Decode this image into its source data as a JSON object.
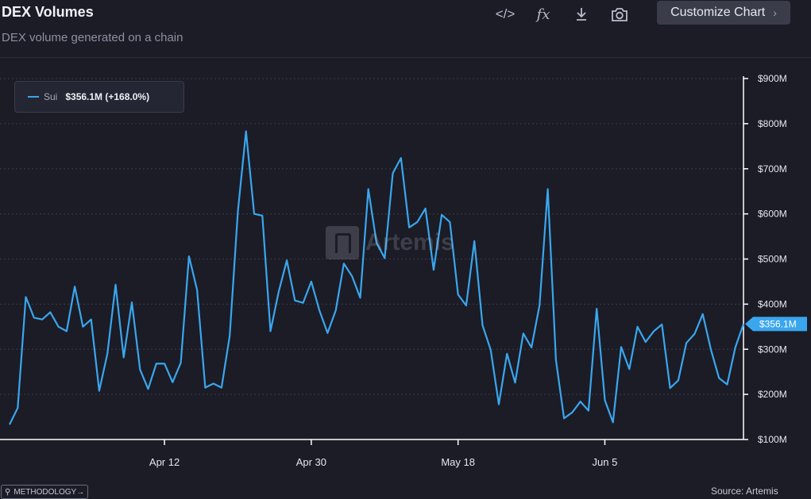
{
  "header": {
    "title": "DEX Volumes",
    "subtitle": "DEX volume generated on a chain",
    "tools": [
      {
        "icon": "code-embed-icon",
        "glyph": "</>"
      },
      {
        "icon": "formula-fx-icon",
        "glyph": "fx"
      },
      {
        "icon": "download-icon"
      },
      {
        "icon": "camera-icon"
      }
    ],
    "customize_label": "Customize Chart",
    "customize_chevron": "›"
  },
  "legend": {
    "series_name": "Sui",
    "value_label": "$356.1M (+168.0%)"
  },
  "watermark": {
    "text": "Artemis"
  },
  "footer": {
    "methodology_label": "METHODOLOGY→",
    "source": "Source: Artemis"
  },
  "colors": {
    "background": "#1b1c26",
    "line": "#3aa6ee",
    "grid": "#3b3d4b",
    "axis": "#ffffff"
  },
  "chart_data": {
    "type": "line",
    "title": "DEX Volumes",
    "subtitle": "DEX volume generated on a chain",
    "x_tick_labels": [
      "Apr 12",
      "Apr 30",
      "May 18",
      "Jun 5"
    ],
    "x_tick_index": [
      19,
      37,
      55,
      73
    ],
    "y_ticks": [
      100,
      200,
      300,
      400,
      500,
      600,
      700,
      800,
      900
    ],
    "y_tick_labels": [
      "$100M",
      "$200M",
      "$300M",
      "$400M",
      "$500M",
      "$600M",
      "$700M",
      "$800M",
      "$900M"
    ],
    "ylim": [
      100,
      900
    ],
    "y_unit": "$M",
    "grid": "horizontal dashed",
    "legend_position": "top-left",
    "last_value_label": "$356.1M",
    "series": [
      {
        "name": "Sui",
        "values": [
          133,
          170,
          416,
          370,
          366,
          382,
          350,
          340,
          439,
          350,
          366,
          208,
          290,
          443,
          282,
          404,
          255,
          212,
          268,
          268,
          227,
          270,
          506,
          432,
          215,
          224,
          215,
          330,
          606,
          783,
          600,
          596,
          340,
          427,
          497,
          408,
          403,
          450,
          386,
          336,
          386,
          490,
          462,
          414,
          655,
          536,
          502,
          690,
          724,
          570,
          582,
          612,
          476,
          598,
          582,
          421,
          397,
          540,
          353,
          299,
          178,
          290,
          226,
          335,
          304,
          398,
          655,
          276,
          147,
          160,
          184,
          164,
          390,
          187,
          138,
          305,
          256,
          350,
          316,
          340,
          355,
          214,
          231,
          314,
          334,
          378,
          300,
          236,
          222,
          304,
          356
        ]
      }
    ]
  }
}
